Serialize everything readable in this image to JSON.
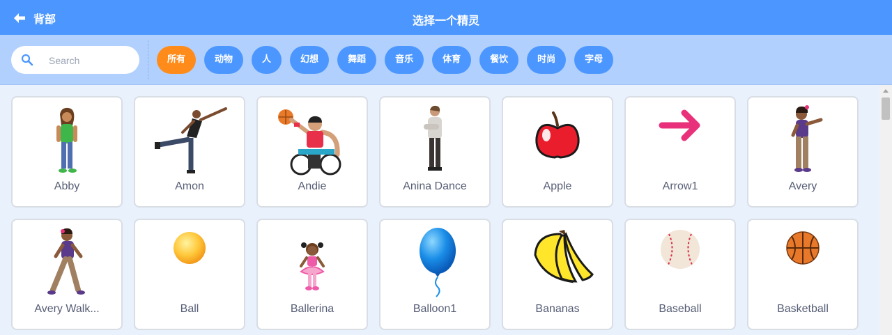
{
  "header": {
    "back_label": "背部",
    "title": "选择一个精灵"
  },
  "search": {
    "placeholder": "Search",
    "value": ""
  },
  "tags": [
    "所有",
    "动物",
    "人",
    "幻想",
    "舞蹈",
    "音乐",
    "体育",
    "餐饮",
    "时尚",
    "字母"
  ],
  "active_tag": "所有",
  "sprites": [
    {
      "name": "Abby",
      "icon": "abby-icon"
    },
    {
      "name": "Amon",
      "icon": "amon-icon"
    },
    {
      "name": "Andie",
      "icon": "andie-icon"
    },
    {
      "name": "Anina Dance",
      "icon": "anina-dance-icon"
    },
    {
      "name": "Apple",
      "icon": "apple-icon"
    },
    {
      "name": "Arrow1",
      "icon": "arrow-icon"
    },
    {
      "name": "Avery",
      "icon": "avery-icon"
    },
    {
      "name": "Avery Walk...",
      "icon": "avery-walking-icon"
    },
    {
      "name": "Ball",
      "icon": "ball-icon"
    },
    {
      "name": "Ballerina",
      "icon": "ballerina-icon"
    },
    {
      "name": "Balloon1",
      "icon": "balloon-icon"
    },
    {
      "name": "Bananas",
      "icon": "bananas-icon"
    },
    {
      "name": "Baseball",
      "icon": "baseball-icon"
    },
    {
      "name": "Basketball",
      "icon": "basketball-icon"
    }
  ],
  "colors": {
    "header": "#4c97ff",
    "filter_bar": "#b1d0fd",
    "active_tag": "#ff8c1a",
    "tag": "#4c97ff",
    "background": "#e9f1fc"
  }
}
